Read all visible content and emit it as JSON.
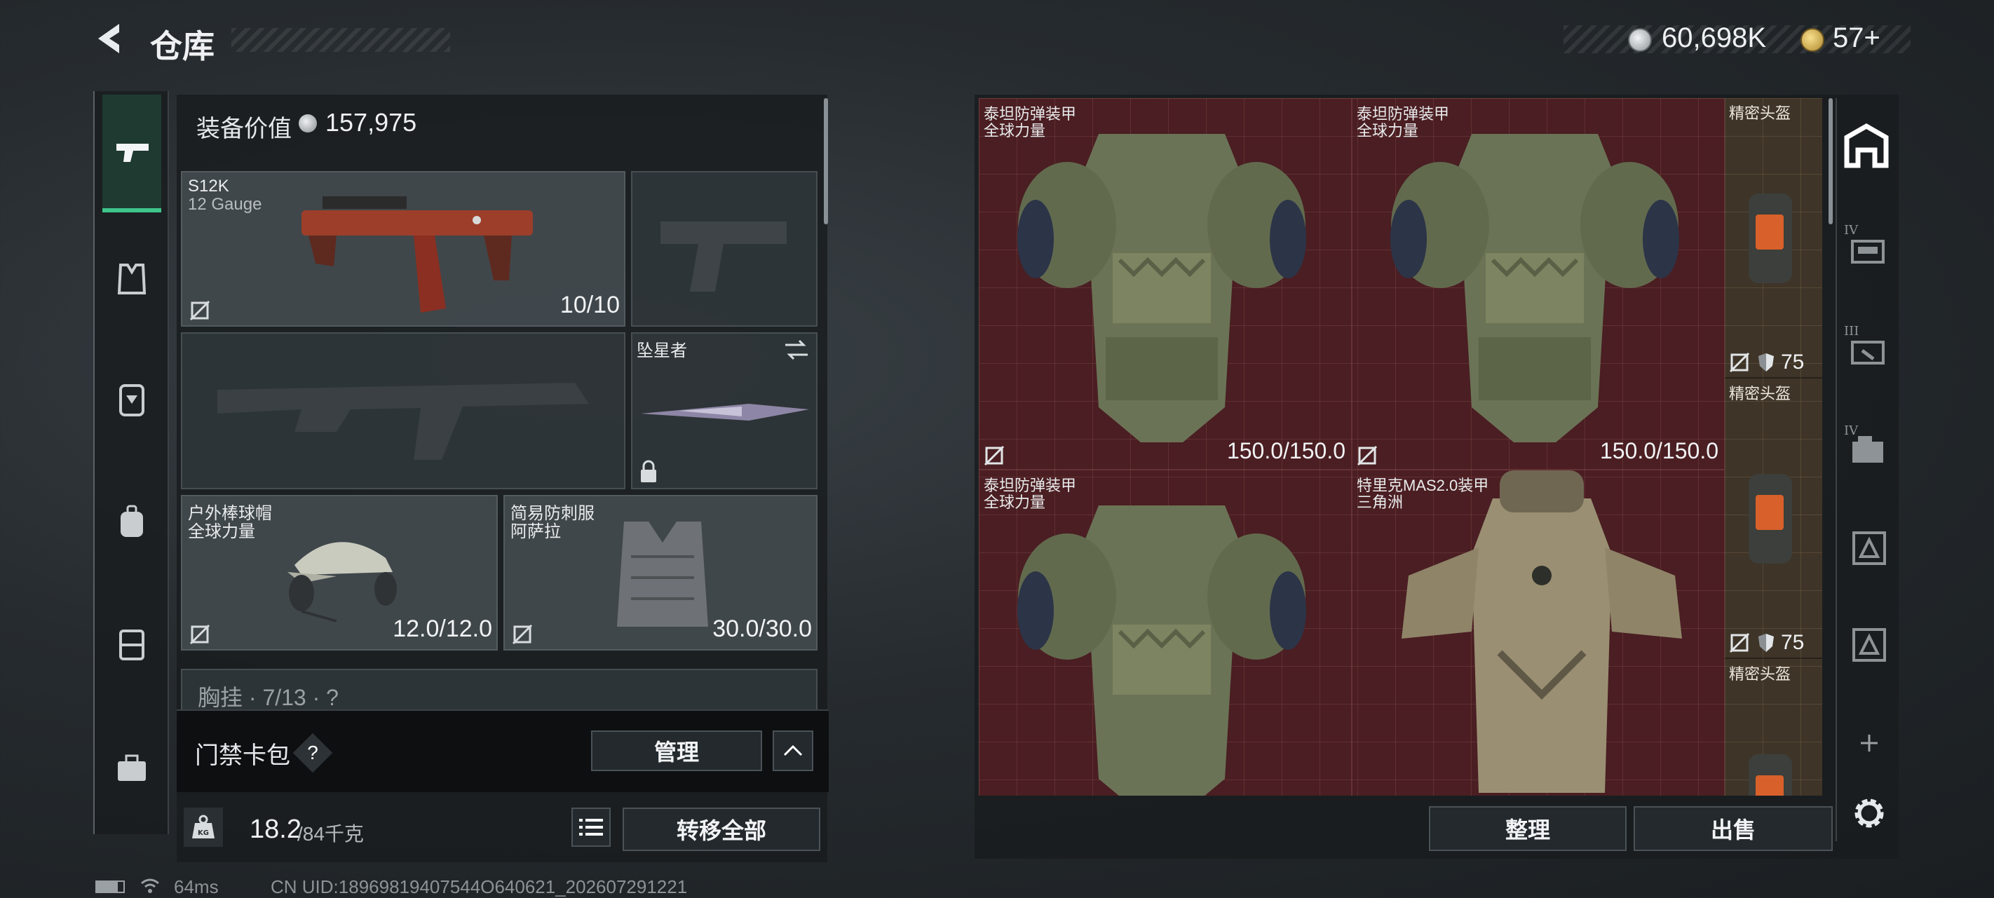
{
  "header": {
    "title": "仓库",
    "currency_amount": "60,698K",
    "coin_amount": "57+"
  },
  "loadout": {
    "equip_value_label": "装备价值",
    "equip_value": "157,975",
    "primary_weapon": {
      "name": "S12K",
      "caliber": "12 Gauge",
      "ammo": "10/10"
    },
    "melee": {
      "name": "坠星者"
    },
    "helmet": {
      "name": "户外棒球帽",
      "faction": "全球力量",
      "durability": "12.0/12.0"
    },
    "armor": {
      "name": "简易防刺服",
      "faction": "阿萨拉",
      "durability": "30.0/30.0"
    },
    "chest_rig_partial": "胸挂 · 7/13 · ?",
    "keycard": {
      "label": "门禁卡包",
      "help": "?",
      "manage_label": "管理"
    },
    "weight": {
      "current": "18.2",
      "max": "/84千克",
      "kg_badge": "KG"
    },
    "transfer_all_label": "转移全部"
  },
  "storage": {
    "items": [
      {
        "name": "泰坦防弹装甲",
        "faction": "全球力量",
        "durability": "150.0/150.0"
      },
      {
        "name": "泰坦防弹装甲",
        "faction": "全球力量",
        "durability": "150.0/150.0"
      },
      {
        "name": "泰坦防弹装甲",
        "faction": "全球力量"
      },
      {
        "name": "特里克MAS2.0装甲",
        "faction": "三角洲"
      }
    ],
    "helmets": [
      {
        "name": "精密头盔",
        "armor_level": "75"
      },
      {
        "name": "精密头盔",
        "armor_level": "75"
      },
      {
        "name": "精密头盔"
      }
    ],
    "sort_label": "整理",
    "sell_label": "出售"
  },
  "sidebar_right": {
    "tab_levels": [
      "IV",
      "III",
      "IV",
      "",
      ""
    ]
  },
  "status_bar": {
    "ping": "64ms",
    "uid": "CN UID:18969819407544O640621_202607291221"
  },
  "colors": {
    "accent_green": "#3fc58c",
    "grid_red": "#4a1e22",
    "gold_slot": "#3e3428"
  }
}
